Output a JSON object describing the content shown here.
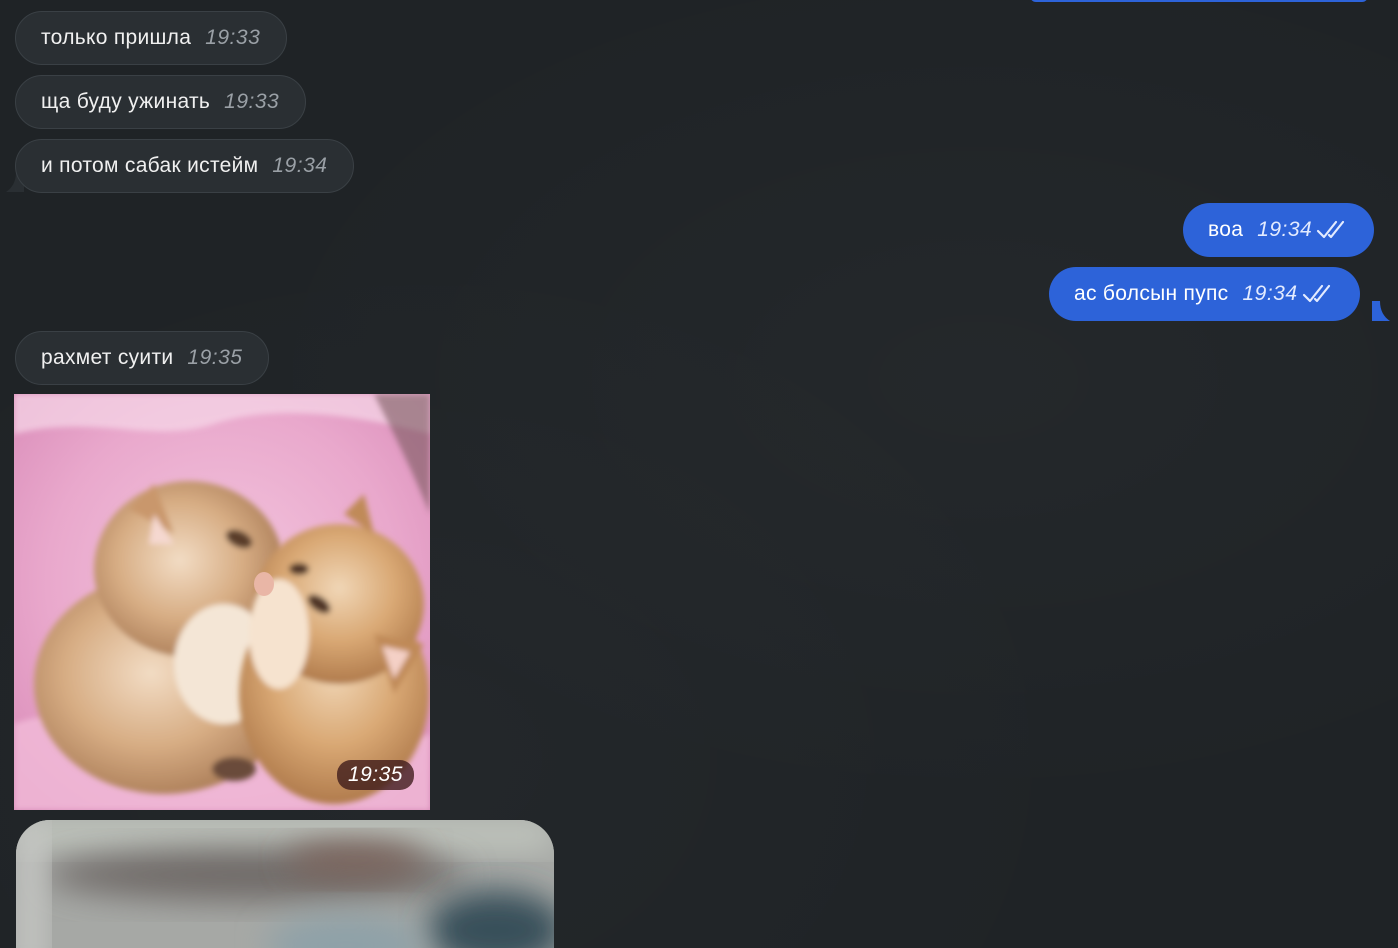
{
  "messages": [
    {
      "id": "m1",
      "direction": "incoming",
      "text": "только пришла",
      "time": "19:33"
    },
    {
      "id": "m2",
      "direction": "incoming",
      "text": "ща буду ужинать",
      "time": "19:33"
    },
    {
      "id": "m3",
      "direction": "incoming",
      "text": "и потом сабак истейм",
      "time": "19:34"
    },
    {
      "id": "m4",
      "direction": "outgoing",
      "text": "воа",
      "time": "19:34",
      "status": "read"
    },
    {
      "id": "m5",
      "direction": "outgoing",
      "text": "ас болсын пупс",
      "time": "19:34",
      "status": "read"
    },
    {
      "id": "m6",
      "direction": "incoming",
      "text": "рахмет суити",
      "time": "19:35"
    },
    {
      "id": "m7",
      "direction": "incoming",
      "type": "photo",
      "time": "19:35"
    }
  ],
  "colors": {
    "background": "#1f2326",
    "incoming_bubble": "#2a2f33",
    "outgoing_bubble": "#2d63d9"
  },
  "icons": {
    "read_status": "double-check-icon"
  }
}
